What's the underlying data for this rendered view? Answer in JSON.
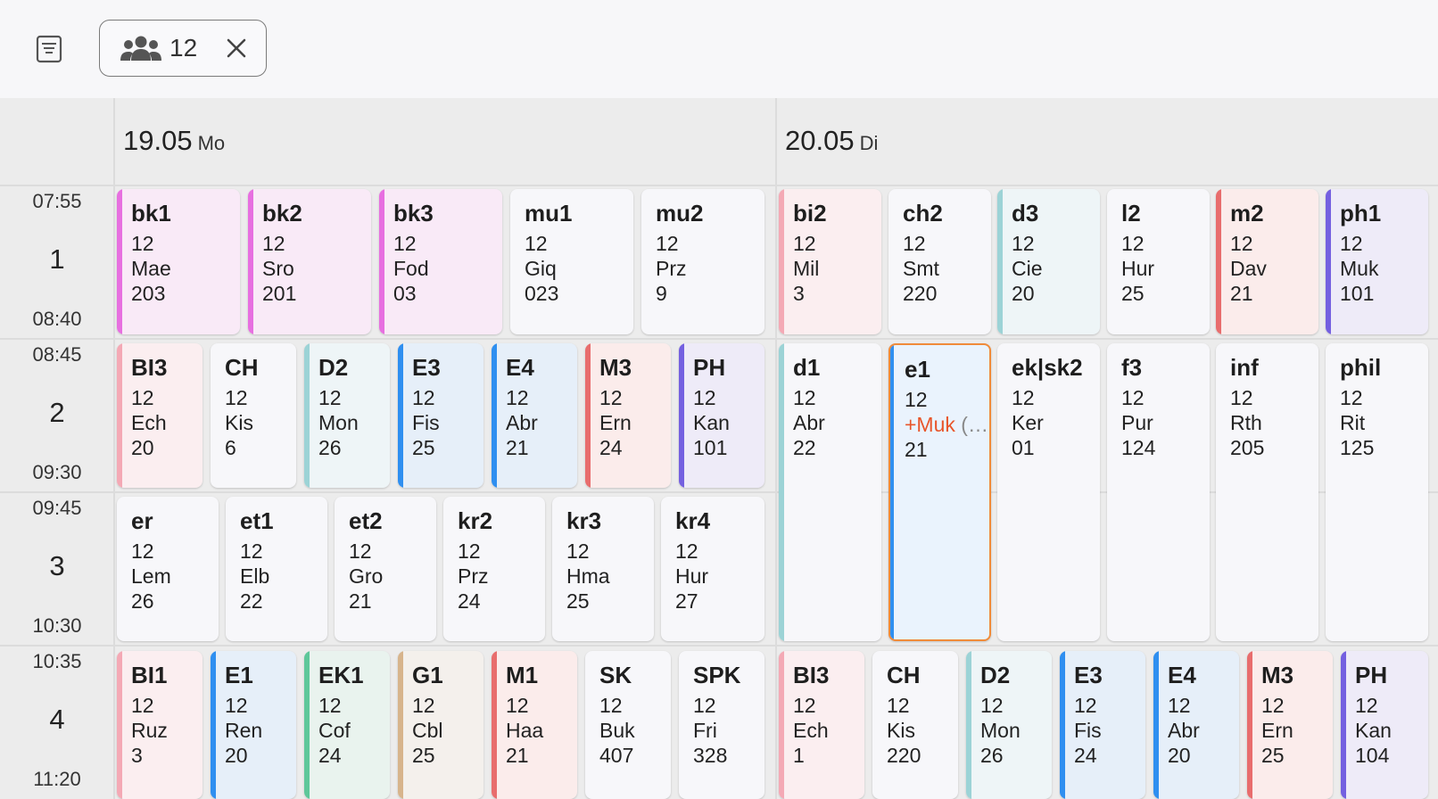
{
  "topbar": {
    "filter_icon": "filter-list-icon",
    "chip": {
      "icon": "group-icon",
      "label": "12",
      "close_icon": "close-icon"
    }
  },
  "days": [
    {
      "date": "19.05",
      "weekday": "Mo"
    },
    {
      "date": "20.05",
      "weekday": "Di"
    }
  ],
  "periods": [
    {
      "num": "1",
      "start": "07:55",
      "end": "08:40"
    },
    {
      "num": "2",
      "start": "08:45",
      "end": "09:30"
    },
    {
      "num": "3",
      "start": "09:45",
      "end": "10:30"
    },
    {
      "num": "4",
      "start": "10:35",
      "end": "11:20"
    }
  ],
  "colors": {
    "pink": "#e76fe0",
    "pinkbg": "#f9eaf7",
    "rose": "#f4a9b5",
    "rosebg": "#fbeef0",
    "red": "#e86d6d",
    "redbg": "#fbeceb",
    "teal": "#9cd3d6",
    "tealbg": "#eef5f7",
    "blue": "#2f8ff0",
    "bluebg": "#e6eff9",
    "purple": "#7460e0",
    "purplebg": "#eeebf8",
    "green": "#5ec79a",
    "greenbg": "#e9f3ee",
    "tan": "#d7b48c",
    "tanbg": "#f4f0ec",
    "none": "transparent",
    "plain": "#f7f7fa",
    "selbg": "#eaf3fd"
  },
  "lessons": [
    {
      "subject": "bk1",
      "cls": "12",
      "teacher": "Mae",
      "room": "203"
    },
    {
      "subject": "bk2",
      "cls": "12",
      "teacher": "Sro",
      "room": "201"
    },
    {
      "subject": "bk3",
      "cls": "12",
      "teacher": "Fod",
      "room": "03"
    },
    {
      "subject": "mu1",
      "cls": "12",
      "teacher": "Giq",
      "room": "023"
    },
    {
      "subject": "mu2",
      "cls": "12",
      "teacher": "Prz",
      "room": "9"
    },
    {
      "subject": "bi2",
      "cls": "12",
      "teacher": "Mil",
      "room": "3"
    },
    {
      "subject": "ch2",
      "cls": "12",
      "teacher": "Smt",
      "room": "220"
    },
    {
      "subject": "d3",
      "cls": "12",
      "teacher": "Cie",
      "room": "20"
    },
    {
      "subject": "l2",
      "cls": "12",
      "teacher": "Hur",
      "room": "25"
    },
    {
      "subject": "m2",
      "cls": "12",
      "teacher": "Dav",
      "room": "21"
    },
    {
      "subject": "ph1",
      "cls": "12",
      "teacher": "Muk",
      "room": "101"
    },
    {
      "subject": "BI3",
      "cls": "12",
      "teacher": "Ech",
      "room": "20"
    },
    {
      "subject": "CH",
      "cls": "12",
      "teacher": "Kis",
      "room": "6"
    },
    {
      "subject": "D2",
      "cls": "12",
      "teacher": "Mon",
      "room": "26"
    },
    {
      "subject": "E3",
      "cls": "12",
      "teacher": "Fis",
      "room": "25"
    },
    {
      "subject": "E4",
      "cls": "12",
      "teacher": "Abr",
      "room": "21"
    },
    {
      "subject": "M3",
      "cls": "12",
      "teacher": "Ern",
      "room": "24"
    },
    {
      "subject": "PH",
      "cls": "12",
      "teacher": "Kan",
      "room": "101"
    },
    {
      "subject": "d1",
      "cls": "12",
      "teacher": "Abr",
      "room": "22"
    },
    {
      "subject": "e1",
      "cls": "12",
      "teacher_sub": "+Muk",
      "teacher_more": "(…",
      "room": "21"
    },
    {
      "subject": "ek|sk2",
      "cls": "12",
      "teacher": "Ker",
      "room": "01"
    },
    {
      "subject": "f3",
      "cls": "12",
      "teacher": "Pur",
      "room": "124"
    },
    {
      "subject": "inf",
      "cls": "12",
      "teacher": "Rth",
      "room": "205"
    },
    {
      "subject": "phil",
      "cls": "12",
      "teacher": "Rit",
      "room": "125"
    },
    {
      "subject": "er",
      "cls": "12",
      "teacher": "Lem",
      "room": "26"
    },
    {
      "subject": "et1",
      "cls": "12",
      "teacher": "Elb",
      "room": "22"
    },
    {
      "subject": "et2",
      "cls": "12",
      "teacher": "Gro",
      "room": "21"
    },
    {
      "subject": "kr2",
      "cls": "12",
      "teacher": "Prz",
      "room": "24"
    },
    {
      "subject": "kr3",
      "cls": "12",
      "teacher": "Hma",
      "room": "25"
    },
    {
      "subject": "kr4",
      "cls": "12",
      "teacher": "Hur",
      "room": "27"
    },
    {
      "subject": "BI1",
      "cls": "12",
      "teacher": "Ruz",
      "room": "3"
    },
    {
      "subject": "E1",
      "cls": "12",
      "teacher": "Ren",
      "room": "20"
    },
    {
      "subject": "EK1",
      "cls": "12",
      "teacher": "Cof",
      "room": "24"
    },
    {
      "subject": "G1",
      "cls": "12",
      "teacher": "Cbl",
      "room": "25"
    },
    {
      "subject": "M1",
      "cls": "12",
      "teacher": "Haa",
      "room": "21"
    },
    {
      "subject": "SK",
      "cls": "12",
      "teacher": "Buk",
      "room": "407"
    },
    {
      "subject": "SPK",
      "cls": "12",
      "teacher": "Fri",
      "room": "328"
    },
    {
      "subject": "BI3",
      "cls": "12",
      "teacher": "Ech",
      "room": "1"
    },
    {
      "subject": "CH",
      "cls": "12",
      "teacher": "Kis",
      "room": "220"
    },
    {
      "subject": "D2",
      "cls": "12",
      "teacher": "Mon",
      "room": "26"
    },
    {
      "subject": "E3",
      "cls": "12",
      "teacher": "Fis",
      "room": "24"
    },
    {
      "subject": "E4",
      "cls": "12",
      "teacher": "Abr",
      "room": "20"
    },
    {
      "subject": "M3",
      "cls": "12",
      "teacher": "Ern",
      "room": "25"
    },
    {
      "subject": "PH",
      "cls": "12",
      "teacher": "Kan",
      "room": "104"
    }
  ]
}
